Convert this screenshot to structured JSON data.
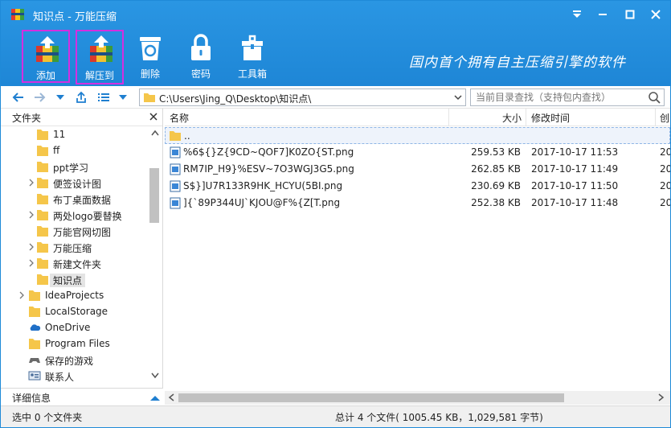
{
  "window": {
    "title": "知识点 - 万能压缩"
  },
  "toolbar": {
    "add_label": "添加",
    "extract_label": "解压到",
    "delete_label": "删除",
    "password_label": "密码",
    "tools_label": "工具箱",
    "slogan": "国内首个拥有自主压缩引擎的软件",
    "highlight_color": "#d42fe0"
  },
  "nav": {
    "path": "C:\\Users\\Jing_Q\\Desktop\\知识点\\",
    "search_placeholder": "当前目录查找（支持包内查找）"
  },
  "left_pane": {
    "header": "文件夹",
    "tree": [
      {
        "label": "11",
        "icon": "folder-icon",
        "expand": false
      },
      {
        "label": "ff",
        "icon": "folder-icon",
        "expand": false
      },
      {
        "label": "ppt学习",
        "icon": "folder-icon",
        "expand": false
      },
      {
        "label": "便签设计图",
        "icon": "folder-icon",
        "expand": true
      },
      {
        "label": "布丁桌面数据",
        "icon": "folder-icon",
        "expand": false
      },
      {
        "label": "两处logo要替换",
        "icon": "folder-icon",
        "expand": true
      },
      {
        "label": "万能官网切图",
        "icon": "folder-icon",
        "expand": false
      },
      {
        "label": "万能压缩",
        "icon": "folder-icon",
        "expand": true
      },
      {
        "label": "新建文件夹",
        "icon": "folder-icon",
        "expand": true
      },
      {
        "label": "知识点",
        "icon": "folder-icon",
        "expand": false,
        "selected": true
      },
      {
        "label": "IdeaProjects",
        "icon": "folder-icon",
        "expand": true
      },
      {
        "label": "LocalStorage",
        "icon": "folder-icon",
        "expand": false
      },
      {
        "label": "OneDrive",
        "icon": "cloud-icon",
        "expand": false
      },
      {
        "label": "Program Files",
        "icon": "folder-icon",
        "expand": false
      },
      {
        "label": "保存的游戏",
        "icon": "game-icon",
        "expand": false
      },
      {
        "label": "联系人",
        "icon": "contacts-icon",
        "expand": false
      }
    ],
    "detail_label": "详细信息"
  },
  "list": {
    "columns": {
      "name": "名称",
      "size": "大小",
      "modified": "修改时间",
      "extra": "创"
    },
    "parent_row": "..",
    "files": [
      {
        "name": "%6${}Z{9CD~QOF7]K0ZO{ST.png",
        "size": "259.53 KB",
        "date": "2017-10-17 11:53",
        "extra": "20"
      },
      {
        "name": "RM7IP_H9}%ESV~7O3WGJ3G5.png",
        "size": "262.85 KB",
        "date": "2017-10-17 11:49",
        "extra": "20"
      },
      {
        "name": "S$}]U7R133R9HK_HCYU(5BI.png",
        "size": "230.69 KB",
        "date": "2017-10-17 11:50",
        "extra": "20"
      },
      {
        "name": "]{`89P344UJ`KJOU@F%{Z[T.png",
        "size": "252.38 KB",
        "date": "2017-10-17 11:48",
        "extra": "20"
      }
    ]
  },
  "status": {
    "left": "选中 0 个文件夹",
    "right": "总计 4 个文件( 1005.45 KB，1,029,581 字节)"
  }
}
